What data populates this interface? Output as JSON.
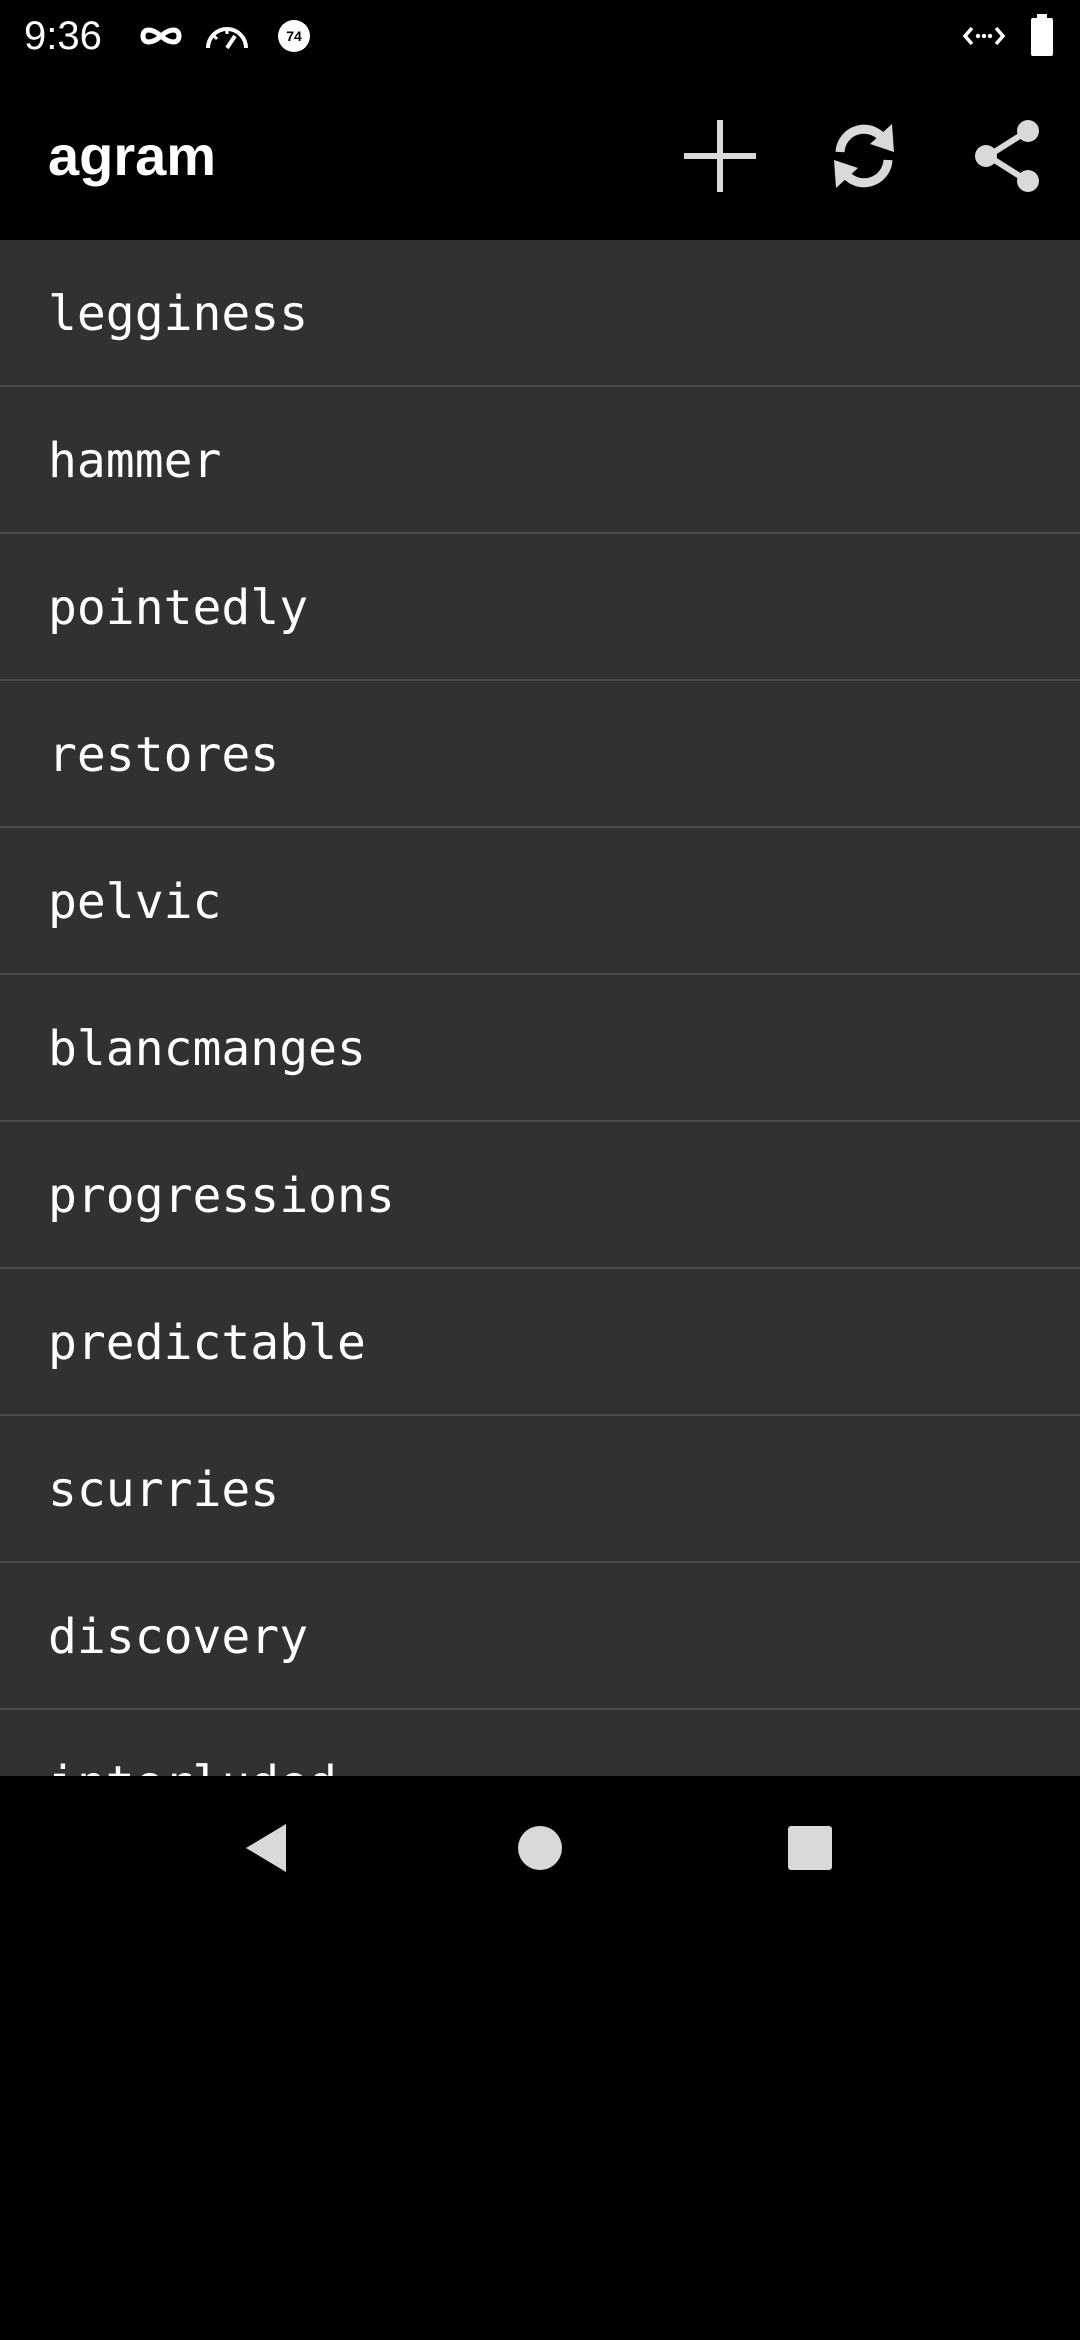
{
  "status_bar": {
    "time": "9:36",
    "left_icons": [
      "incognito-icon",
      "speedometer-icon",
      "notification-badge-icon"
    ],
    "badge_number": "74",
    "right_icons": [
      "code-arrows-icon",
      "battery-icon"
    ]
  },
  "app_bar": {
    "title": "agram",
    "actions": [
      "add-icon",
      "refresh-icon",
      "share-icon"
    ]
  },
  "words": [
    "legginess",
    "hammer",
    "pointedly",
    "restores",
    "pelvic",
    "blancmanges",
    "progressions",
    "predictable",
    "scurries",
    "discovery",
    "interluded"
  ],
  "nav_bar": {
    "buttons": [
      "back-icon",
      "home-icon",
      "recents-icon"
    ]
  },
  "colors": {
    "background": "#000000",
    "list_background": "#313131",
    "divider": "#4a4a4a",
    "text": "#ffffff",
    "icon": "#d9d9d9"
  }
}
